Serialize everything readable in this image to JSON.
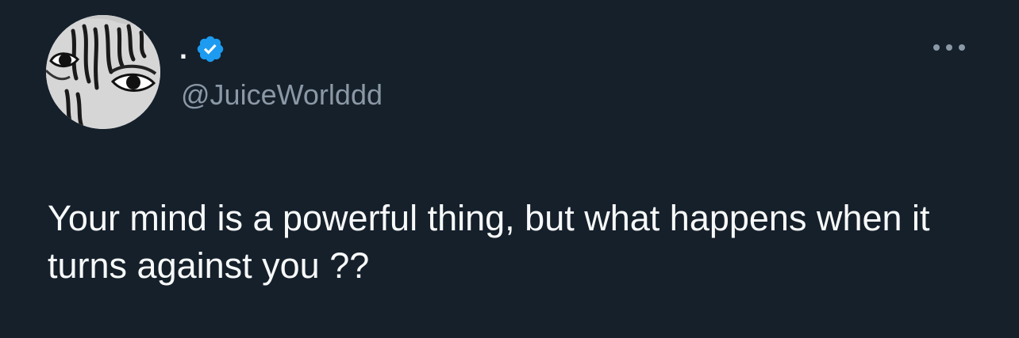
{
  "tweet": {
    "author": {
      "display_name": ".",
      "handle": "@JuiceWorlddd",
      "verified": true,
      "avatar_description": "black and white close-up face with dreadlocks"
    },
    "text": "Your mind is a powerful thing, but what happens when it turns against you ??",
    "icons": {
      "verified": "verified-badge-icon",
      "more": "more-options-icon"
    }
  },
  "colors": {
    "background": "#15202b",
    "text_primary": "#f7f9f9",
    "text_secondary": "#8b98a5",
    "verified_blue": "#1d9bf0"
  }
}
